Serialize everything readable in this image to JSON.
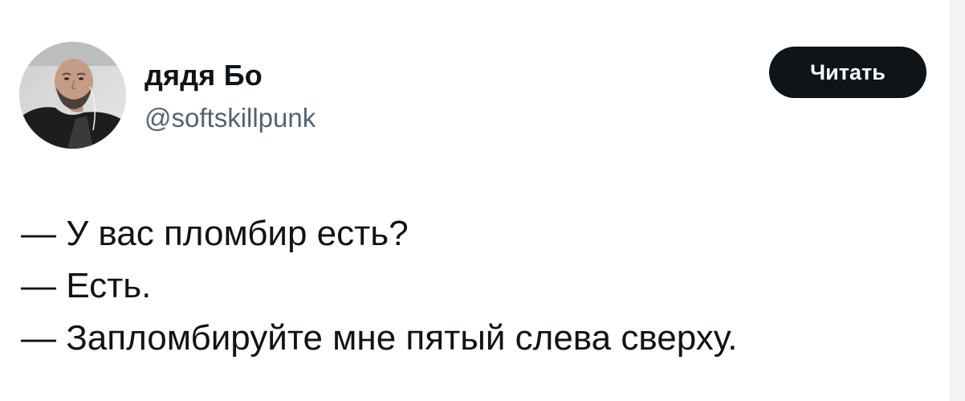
{
  "author": {
    "display_name": "дядя Бо",
    "handle": "@softskillpunk"
  },
  "follow_button": {
    "label": "Читать"
  },
  "tweet": {
    "lines": [
      "— У вас пломбир есть?",
      "— Есть.",
      "— Запломбируйте мне пятый слева сверху."
    ]
  },
  "colors": {
    "text": "#0f1419",
    "secondary_text": "#536471",
    "button_bg": "#0f1419",
    "button_text": "#ffffff"
  }
}
